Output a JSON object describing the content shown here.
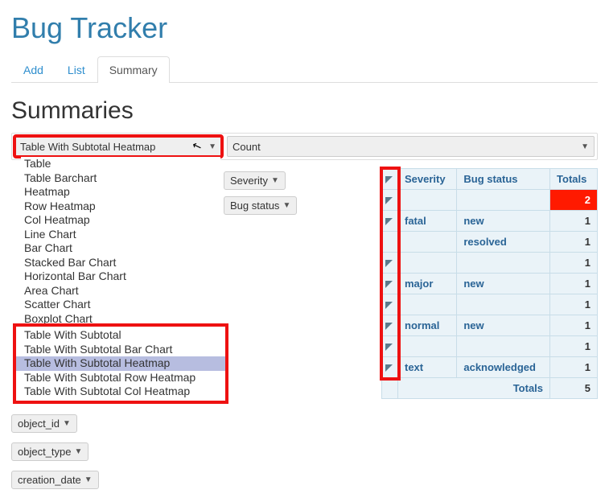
{
  "app_title": "Bug Tracker",
  "tabs": {
    "add": "Add",
    "list": "List",
    "summary": "Summary"
  },
  "section_heading": "Summaries",
  "renderer_select": {
    "current": "Table With Subtotal Heatmap",
    "options_top": [
      "Table",
      "Table Barchart",
      "Heatmap",
      "Row Heatmap",
      "Col Heatmap",
      "Line Chart",
      "Bar Chart",
      "Stacked Bar Chart",
      "Horizontal Bar Chart",
      "Area Chart",
      "Scatter Chart",
      "Boxplot Chart"
    ],
    "options_hl": [
      "Table With Subtotal",
      "Table With Subtotal Bar Chart",
      "Table With Subtotal Heatmap",
      "Table With Subtotal Row Heatmap",
      "Table With Subtotal Col Heatmap"
    ]
  },
  "aggregator_select": {
    "current": "Count"
  },
  "row_attrs": [
    "Severity",
    "Bug status"
  ],
  "extra_fields": [
    "object_id",
    "object_type",
    "creation_date"
  ],
  "pivot": {
    "cols": [
      "Severity",
      "Bug status",
      "Totals"
    ],
    "rows": [
      {
        "sev": "",
        "status": "",
        "val": "2",
        "hot": true
      },
      {
        "sev": "fatal",
        "status": "new",
        "val": "1"
      },
      {
        "sev": "",
        "status": "resolved",
        "val": "1"
      },
      {
        "sev": "",
        "status": "",
        "val": "1"
      },
      {
        "sev": "major",
        "status": "new",
        "val": "1"
      },
      {
        "sev": "",
        "status": "",
        "val": "1"
      },
      {
        "sev": "normal",
        "status": "new",
        "val": "1"
      },
      {
        "sev": "",
        "status": "",
        "val": "1"
      },
      {
        "sev": "text",
        "status": "acknowledged",
        "val": "1"
      }
    ],
    "totals_label": "Totals",
    "totals_val": "5"
  }
}
